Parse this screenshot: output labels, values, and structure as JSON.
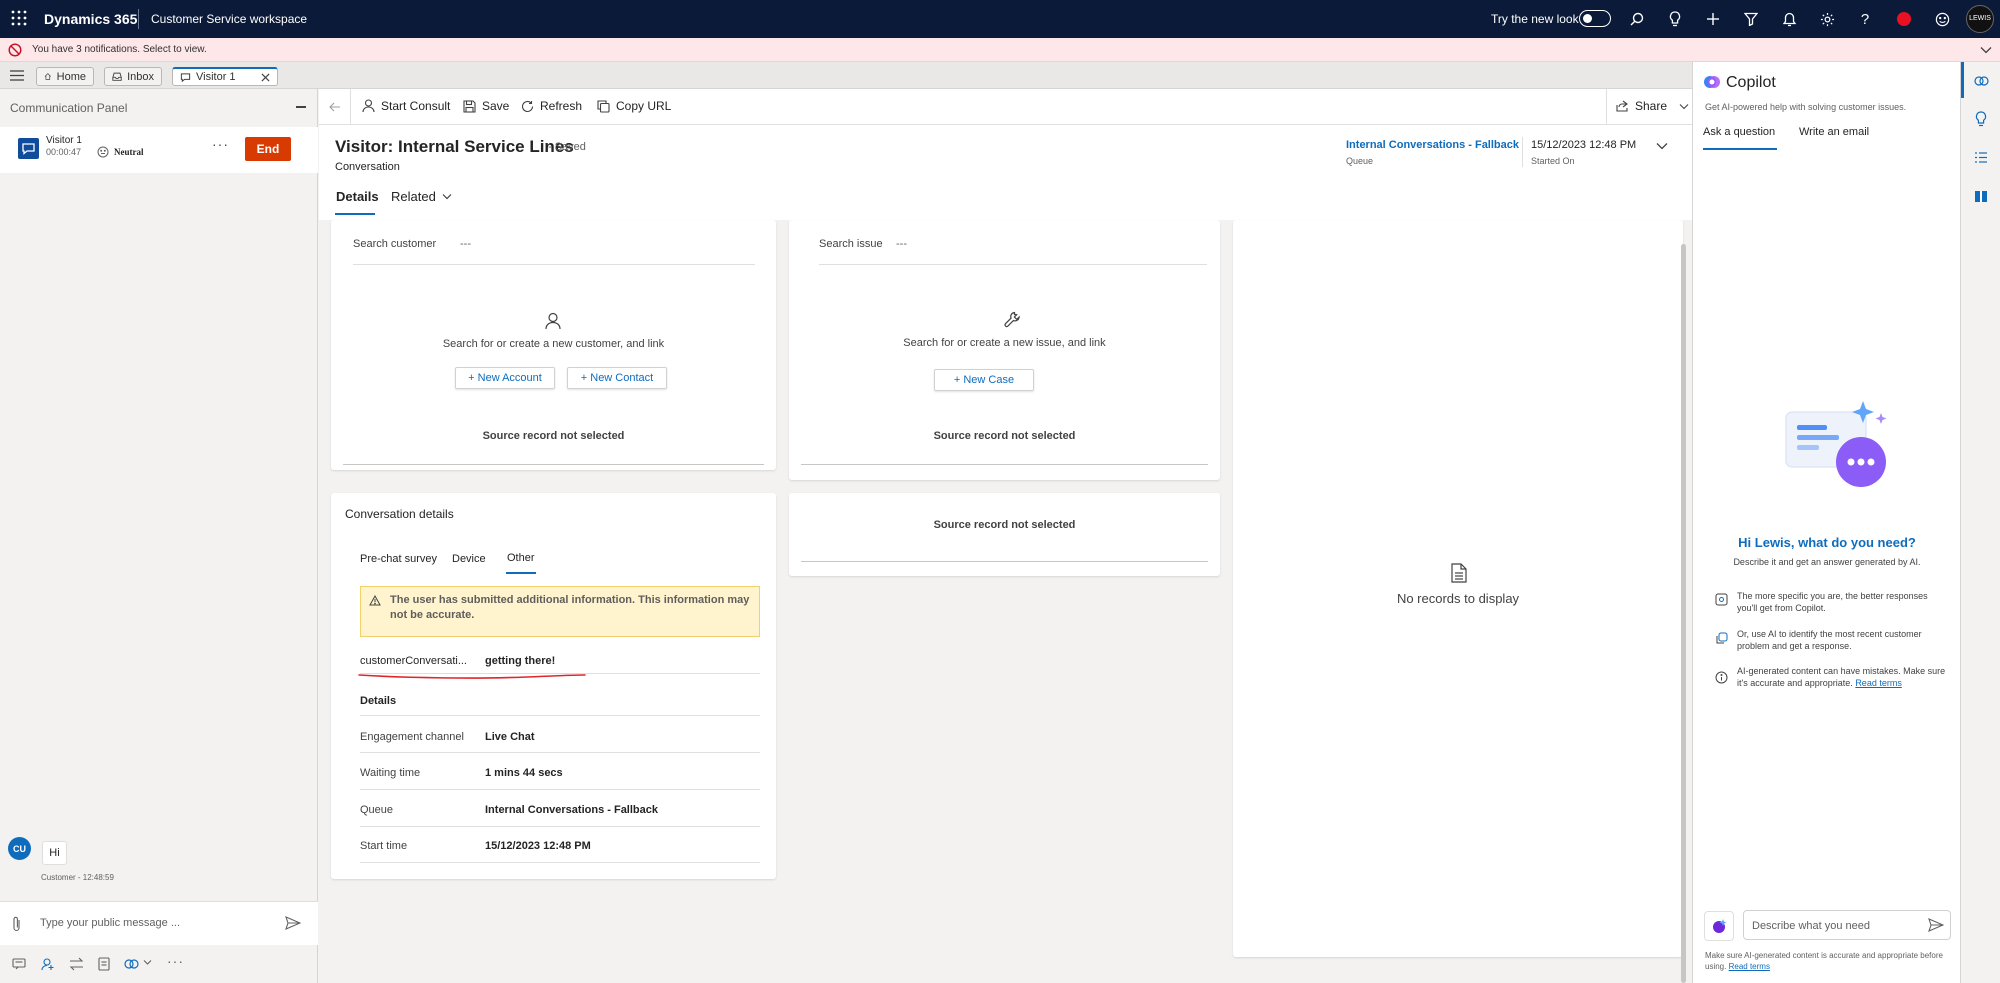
{
  "topbar": {
    "brand": "Dynamics 365",
    "workspace": "Customer Service workspace",
    "new_look_label": "Try the new look",
    "avatar_text": "LEWIS"
  },
  "notification": {
    "text": "You have 3 notifications. Select to view."
  },
  "tabs": [
    {
      "label": "Home"
    },
    {
      "label": "Inbox"
    },
    {
      "label": "Visitor 1"
    }
  ],
  "comm_panel": {
    "title": "Communication Panel",
    "session": {
      "name": "Visitor 1",
      "timer": "00:00:47",
      "sentiment": "Neutral",
      "end_label": "End"
    },
    "message": {
      "avatar": "CU",
      "text": "Hi",
      "meta": "Customer - 12:48:59"
    },
    "composer_placeholder": "Type your public message ..."
  },
  "command_bar": {
    "start_consult": "Start Consult",
    "save": "Save",
    "refresh": "Refresh",
    "copy_url": "Copy URL",
    "share": "Share"
  },
  "record": {
    "title": "Visitor: Internal Service Lines",
    "saved_status": "- Saved",
    "entity": "Conversation",
    "queue_value": "Internal Conversations - Fallback",
    "queue_label": "Queue",
    "started_value": "15/12/2023 12:48 PM",
    "started_label": "Started On",
    "tab_details": "Details",
    "tab_related": "Related"
  },
  "customer_card": {
    "field_label": "Search customer",
    "field_value": "---",
    "hint": "Search for or create a new customer, and link",
    "new_account": "+ New Account",
    "new_contact": "+ New Contact",
    "source": "Source record not selected"
  },
  "issue_card": {
    "field_label": "Search issue",
    "field_value": "---",
    "hint": "Search for or create a new issue, and link",
    "new_case": "+ New Case",
    "source": "Source record not selected"
  },
  "source_card2": {
    "text": "Source record not selected"
  },
  "records_panel": {
    "empty": "No records to display"
  },
  "conversation_details": {
    "title": "Conversation details",
    "tabs": [
      "Pre-chat survey",
      "Device",
      "Other"
    ],
    "warning": "The user has submitted additional information. This information may not be accurate.",
    "custom_label": "customerConversati...",
    "custom_value": "getting there!",
    "details_heading": "Details",
    "rows": [
      {
        "label": "Engagement channel",
        "value": "Live Chat"
      },
      {
        "label": "Waiting time",
        "value": "1 mins 44 secs"
      },
      {
        "label": "Queue",
        "value": "Internal Conversations - Fallback"
      },
      {
        "label": "Start time",
        "value": "15/12/2023 12:48 PM"
      }
    ]
  },
  "copilot": {
    "title": "Copilot",
    "subtitle": "Get AI-powered help with solving customer issues.",
    "tab_ask": "Ask a question",
    "tab_email": "Write an email",
    "greeting": "Hi Lewis, what do you need?",
    "description": "Describe it and get an answer generated by AI.",
    "tip1": "The more specific you are, the better responses you'll get from Copilot.",
    "tip2": "Or, use AI to identify the most recent customer problem and get a response.",
    "tip3": "AI-generated content can have mistakes. Make sure it's accurate and appropriate.",
    "read_terms": "Read terms",
    "input_placeholder": "Describe what you need",
    "footer": "Make sure AI-generated content is accurate and appropriate before using.",
    "footer_link": "Read terms"
  },
  "colors": {
    "nav": "#0b1a38",
    "accent": "#0f6cbd",
    "end_button": "#d83b01",
    "notification_bg": "#fde7e9",
    "annotation": "#e0262b"
  }
}
